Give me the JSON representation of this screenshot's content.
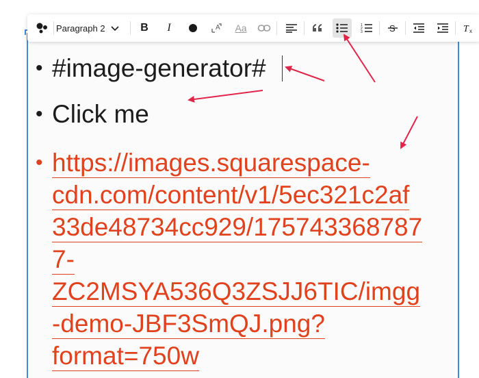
{
  "toolbar": {
    "block_style": "Paragraph 2",
    "buttons": [
      {
        "name": "shapes-menu-icon"
      },
      {
        "name": "bold-button",
        "label": "B"
      },
      {
        "name": "italic-button",
        "label": "I"
      },
      {
        "name": "text-color-button"
      },
      {
        "name": "font-size-button"
      },
      {
        "name": "text-style-button",
        "label": "Aa"
      },
      {
        "name": "link-button"
      },
      {
        "name": "align-left-button"
      },
      {
        "name": "quote-button"
      },
      {
        "name": "bulleted-list-button",
        "active": true
      },
      {
        "name": "numbered-list-button"
      },
      {
        "name": "strikethrough-button"
      },
      {
        "name": "outdent-button"
      },
      {
        "name": "indent-button"
      },
      {
        "name": "clear-formatting-button"
      }
    ]
  },
  "content": {
    "items": [
      {
        "text": "#image-generator#"
      },
      {
        "text": "Click me"
      },
      {
        "link_lines": [
          "https://images.squarespace-",
          "cdn.com/content/v1/5ec321c2af",
          "33de48734cc929/175743368787",
          "7-",
          "ZC2MSYA536Q3ZSJJ6TIC/imgg",
          "-demo-JBF3SmQJ.png?",
          "format=750w"
        ]
      }
    ],
    "bullet": "•"
  },
  "colors": {
    "accent_border": "#3e8bd4",
    "link": "#e0421d",
    "annotation_arrow": "#e0254a",
    "active_button_bg": "#e4e4e4"
  }
}
